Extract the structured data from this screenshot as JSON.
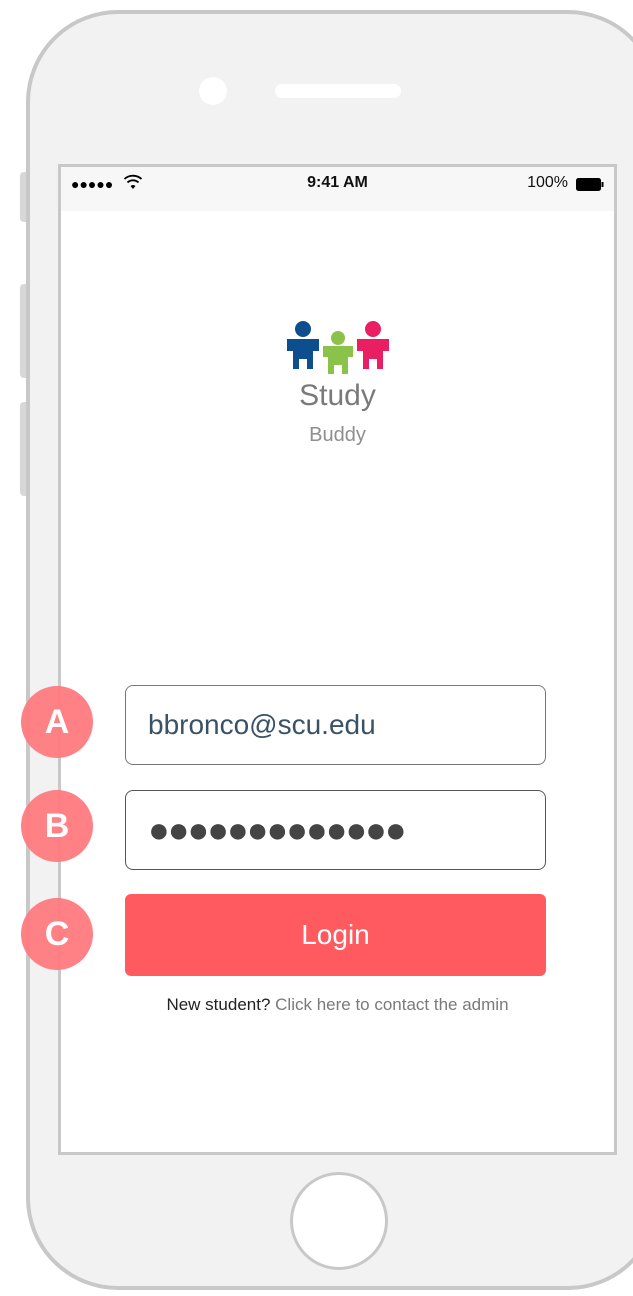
{
  "status_bar": {
    "signal": "●●●●●",
    "time": "9:41 AM",
    "battery_percent": "100%",
    "wifi_icon": "wifi-icon",
    "battery_icon": "battery-full-icon"
  },
  "logo": {
    "icon": "puzzle-people-logo",
    "word": "Study",
    "subtitle": "Buddy",
    "colors": [
      "#0d4f8e",
      "#8bc34a",
      "#e91e63"
    ]
  },
  "login": {
    "email_value": "bbronco@scu.edu",
    "password_masked": "●●●●●●●●●●●●●",
    "button_label": "Login",
    "button_color": "#ff5a60"
  },
  "signup": {
    "prefix": "New student?",
    "link": "Click here to contact the admin"
  },
  "annotations": {
    "a": "A",
    "b": "B",
    "c": "C",
    "color": "#ff7b80"
  }
}
